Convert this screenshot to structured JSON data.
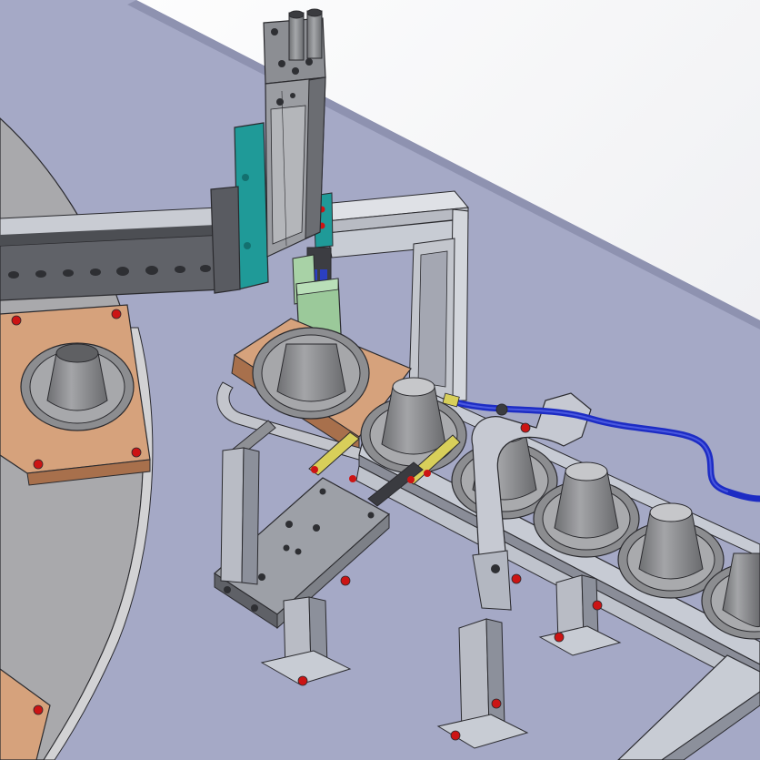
{
  "colors": {
    "background_white": "#fbfbfc",
    "floor": "#a5a9c6",
    "floor_light": "#b3b7d1",
    "turntable": "#a8a8aa",
    "turntable_edge": "#cfcfd1",
    "fixture_wood": "#d6a27c",
    "wood_dark": "#a8704c",
    "frame_metal": "#c8ccd4",
    "metal_dark": "#6e7078",
    "cylinder": "#8f9194",
    "teal": "#1f9a98",
    "gripper_green": "#9bc99a",
    "brass": "#d8cf5a",
    "hose_blue": "#1d2cc4",
    "bolt_red": "#cc1414",
    "cup": "#8e8f92",
    "cup_light": "#c4c5c8",
    "outline": "#2a2a2e"
  },
  "icons": [
    "robot-arm-icon",
    "conveyor-icon",
    "bolt-icon",
    "hose-icon"
  ]
}
